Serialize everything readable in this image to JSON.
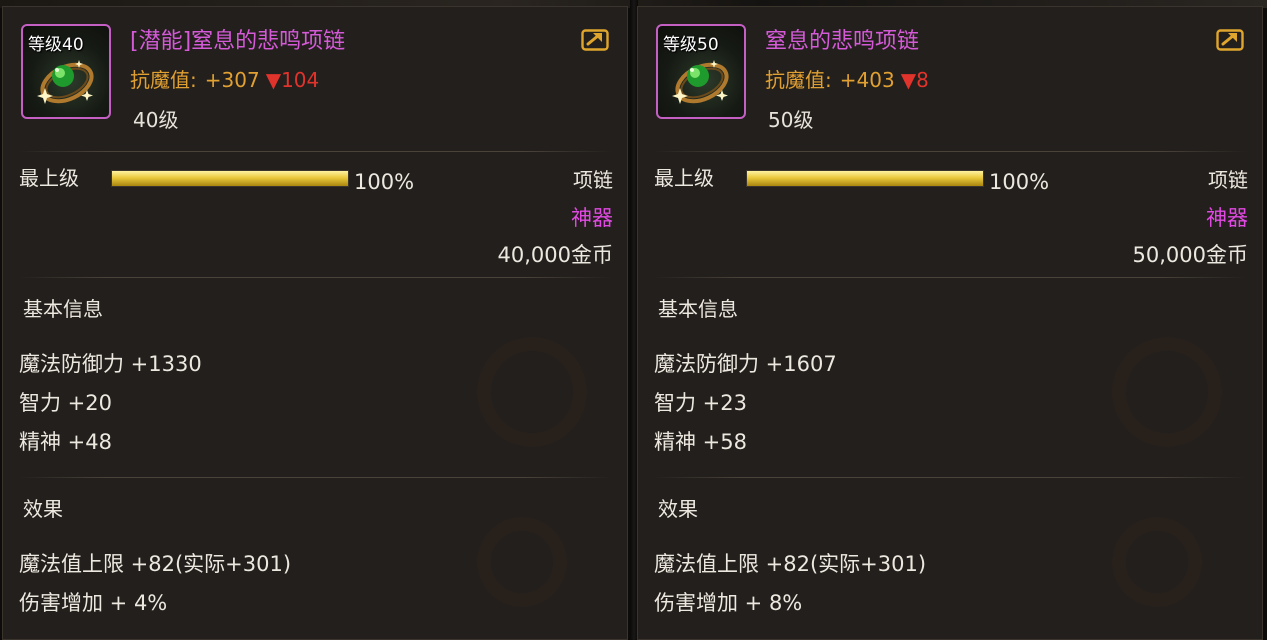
{
  "items": [
    {
      "icon_level": "等级40",
      "name": "[潜能]窒息的悲鸣项链",
      "resist_label": "抗魔值:",
      "resist_value": "+307",
      "resist_diff": "▼104",
      "item_level": "40级",
      "grade_label": "最上级",
      "grade_percent": "100%",
      "grade_fill": 1.0,
      "type": "项链",
      "rarity": "神器",
      "price": "40,000金币",
      "base_info_title": "基本信息",
      "stats": [
        "魔法防御力 +1330",
        "智力 +20",
        "精神 +48"
      ],
      "effect_title": "效果",
      "effects": [
        "魔法值上限 +82(实际+301)",
        "伤害增加 + 4%"
      ]
    },
    {
      "icon_level": "等级50",
      "name": "窒息的悲鸣项链",
      "resist_label": "抗魔值:",
      "resist_value": "+403",
      "resist_diff": "▼8",
      "item_level": "50级",
      "grade_label": "最上级",
      "grade_percent": "100%",
      "grade_fill": 1.0,
      "type": "项链",
      "rarity": "神器",
      "price": "50,000金币",
      "base_info_title": "基本信息",
      "stats": [
        "魔法防御力 +1607",
        "智力 +23",
        "精神 +58"
      ],
      "effect_title": "效果",
      "effects": [
        "魔法值上限 +82(实际+301)",
        "伤害增加 + 8%"
      ]
    }
  ],
  "colors": {
    "panel_bg": "#221f1c",
    "name_purple": "#d45ad8",
    "rarity_magenta": "#e04ae2",
    "resist_orange": "#e1a032",
    "diff_red": "#e0332c",
    "text_light": "#ede8df",
    "grade_gold": "#eac93c",
    "icon_border": "#c45fc4"
  },
  "icons": {
    "item_icon": "emerald-necklace-icon",
    "share_icon": "share-arrow-icon"
  }
}
